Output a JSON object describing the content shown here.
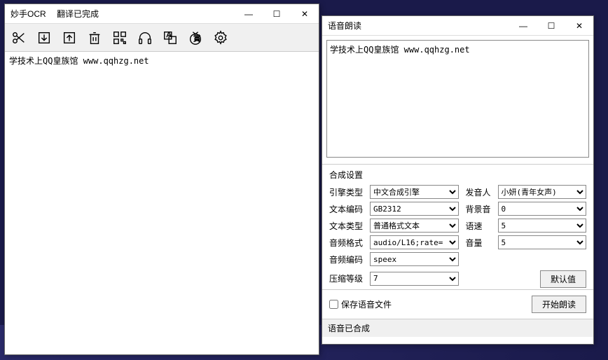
{
  "ocr": {
    "title_app": "妙手OCR",
    "title_status": "翻译已完成",
    "content": "学技术上QQ皇族馆 www.qqhzg.net"
  },
  "tts": {
    "title": "语音朗读",
    "content": "学技术上QQ皇族馆 www.qqhzg.net",
    "settings_title": "合成设置",
    "labels": {
      "engine": "引擎类型",
      "encoding": "文本编码",
      "text_type": "文本类型",
      "audio_format": "音频格式",
      "audio_encoding": "音频编码",
      "compress": "压缩等级",
      "voice": "发音人",
      "bg_sound": "背景音",
      "speed": "语速",
      "volume": "音量"
    },
    "values": {
      "engine": "中文合成引擎",
      "encoding": "GB2312",
      "text_type": "普通格式文本",
      "audio_format": "audio/L16;rate=",
      "audio_encoding": "speex",
      "compress": "7",
      "voice": "小妍(青年女声)",
      "bg_sound": "0",
      "speed": "5",
      "volume": "5"
    },
    "btn_default": "默认值",
    "chk_save": "保存语音文件",
    "btn_start": "开始朗读",
    "status": "语音已合成"
  },
  "win_controls": {
    "min": "—",
    "max": "☐",
    "close": "✕"
  }
}
